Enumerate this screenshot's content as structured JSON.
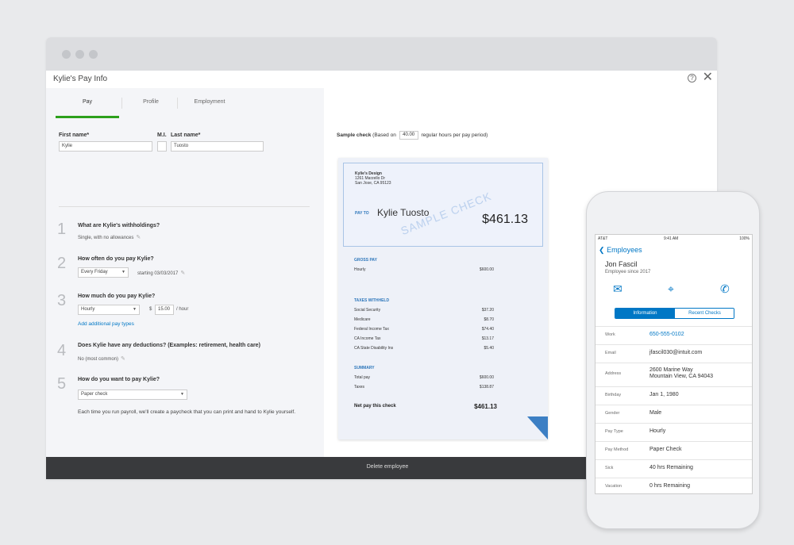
{
  "window": {
    "title": "Kylie's Pay Info",
    "tabs": [
      "Pay",
      "Profile",
      "Employment"
    ]
  },
  "name_fields": {
    "first_label": "First name*",
    "first_value": "Kylie",
    "mi_label": "M.I.",
    "last_label": "Last name*",
    "last_value": "Tuosto"
  },
  "steps": [
    {
      "num": "1",
      "question": "What are Kylie's withholdings?",
      "answer": "Single, with no allowances"
    },
    {
      "num": "2",
      "question": "How often do you pay Kylie?",
      "select": "Every Friday",
      "extra": "starting 03/03/2017"
    },
    {
      "num": "3",
      "question": "How much do you pay Kylie?",
      "select": "Hourly",
      "currency": "$",
      "rate": "15.00",
      "unit": "/ hour",
      "link": "Add additional pay types"
    },
    {
      "num": "4",
      "question": "Does Kylie have any deductions? (Examples: retirement, health care)",
      "answer": "No (most common)"
    },
    {
      "num": "5",
      "question": "How do you want to pay Kylie?",
      "select": "Paper check",
      "note": "Each time you run payroll, we'll create a paycheck that you can print and hand to Kylie yourself."
    }
  ],
  "sample": {
    "caption_bold": "Sample check",
    "caption_pre": "(Based on",
    "hours": "40.00",
    "caption_post": "regular hours per pay period)"
  },
  "check": {
    "company_name": "Kylie's Design",
    "company_addr1": "1261 Marzello Dr",
    "company_addr2": "San Jose, CA 95123",
    "payto_label": "PAY TO",
    "payee": "Kylie Tuosto",
    "amount": "$461.13",
    "watermark": "SAMPLE CHECK",
    "gross_title": "GROSS PAY",
    "gross_rows": [
      {
        "label": "Hourly",
        "value": "$600.00"
      }
    ],
    "taxes_title": "TAXES WITHHELD",
    "tax_rows": [
      {
        "label": "Social Security",
        "value": "$37.20"
      },
      {
        "label": "Medicare",
        "value": "$8.70"
      },
      {
        "label": "Federal Income Tax",
        "value": "$74.40"
      },
      {
        "label": "CA Income Tax",
        "value": "$13.17"
      },
      {
        "label": "CA State Disability Ins",
        "value": "$5.40"
      }
    ],
    "summary_title": "SUMMARY",
    "summary_rows": [
      {
        "label": "Total pay",
        "value": "$600.00"
      },
      {
        "label": "Taxes",
        "value": "$138.87"
      }
    ],
    "net_label": "Net pay this check",
    "net_value": "$461.13"
  },
  "footer": {
    "delete_label": "Delete employee"
  },
  "phone": {
    "carrier": "AT&T",
    "time": "9:41 AM",
    "battery": "100%",
    "back_label": "Employees",
    "name": "Jon Fascil",
    "since": "Employee since 2017",
    "seg_on": "Information",
    "seg_off": "Recent Checks",
    "rows": [
      {
        "key": "Work",
        "value": "650-555-0102",
        "blue": true
      },
      {
        "key": "Email",
        "value": "jfascil030@intuit.com",
        "blue": false
      },
      {
        "key": "Address",
        "value": "2600 Marine Way",
        "value2": "Mountain View, CA 94043",
        "blue": false
      },
      {
        "key": "Birthday",
        "value": "Jan 1, 1980",
        "blue": false
      },
      {
        "key": "Gender",
        "value": "Male",
        "blue": false
      },
      {
        "key": "Pay Type",
        "value": "Hourly",
        "blue": false
      },
      {
        "key": "Pay Method",
        "value": "Paper Check",
        "blue": false
      },
      {
        "key": "Sick",
        "value": "40 hrs Remaining",
        "blue": false
      },
      {
        "key": "Vacation",
        "value": "0 hrs Remaining",
        "blue": false
      }
    ]
  },
  "colors": {
    "accent_green": "#2ca01c",
    "link_blue": "#0077c5",
    "footer_dark": "#393a3d"
  }
}
